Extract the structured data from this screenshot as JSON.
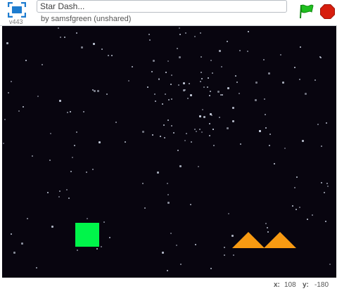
{
  "header": {
    "version": "v443",
    "project_title": "Star Dash...",
    "byline": "by samsfgreen (unshared)"
  },
  "icons": {
    "fullscreen": "fullscreen-icon",
    "green_flag": "green-flag-icon",
    "stop": "stop-sign-icon"
  },
  "colors": {
    "stage_background": "#08050f",
    "player": "#00f54a",
    "spike": "#f79a12",
    "flag": "#1fbf1f",
    "stop": "#d71e0e",
    "fullscreen_icon": "#1e7ccf"
  },
  "status": {
    "x_label": "x:",
    "x_value": "108",
    "y_label": "y:",
    "y_value": "-180"
  }
}
